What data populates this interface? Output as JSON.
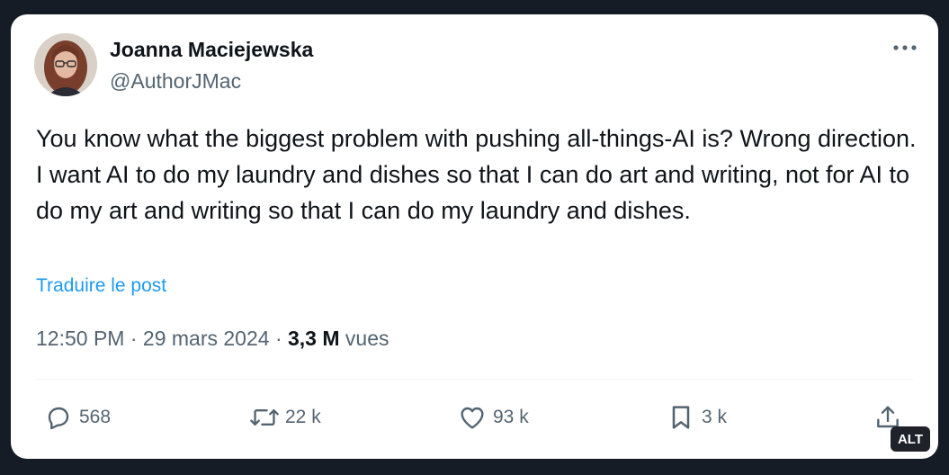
{
  "author": {
    "name": "Joanna Maciejewska",
    "handle": "@AuthorJMac"
  },
  "tweet": {
    "line1": "You know what the biggest problem with pushing all-things-AI is? Wrong direction.",
    "line2": "I want AI to do my laundry and dishes so that I can do art and writing, not for AI to do my art and writing so that I can do my laundry and dishes.",
    "translate_label": "Traduire le post"
  },
  "meta": {
    "time": "12:50 PM",
    "date": "29 mars 2024",
    "separator": "·",
    "views_count": "3,3 M",
    "views_label": "vues"
  },
  "actions": {
    "reply_count": "568",
    "retweet_count": "22 k",
    "like_count": "93 k",
    "bookmark_count": "3 k"
  },
  "alt_badge": "ALT",
  "icons": {
    "more": "more-horizontal-icon",
    "reply": "reply-icon",
    "retweet": "retweet-icon",
    "like": "heart-icon",
    "bookmark": "bookmark-icon",
    "share": "share-icon"
  },
  "colors": {
    "background": "#161c26",
    "card": "#ffffff",
    "text": "#0f1419",
    "secondary": "#536471",
    "link": "#1d9bf0"
  }
}
